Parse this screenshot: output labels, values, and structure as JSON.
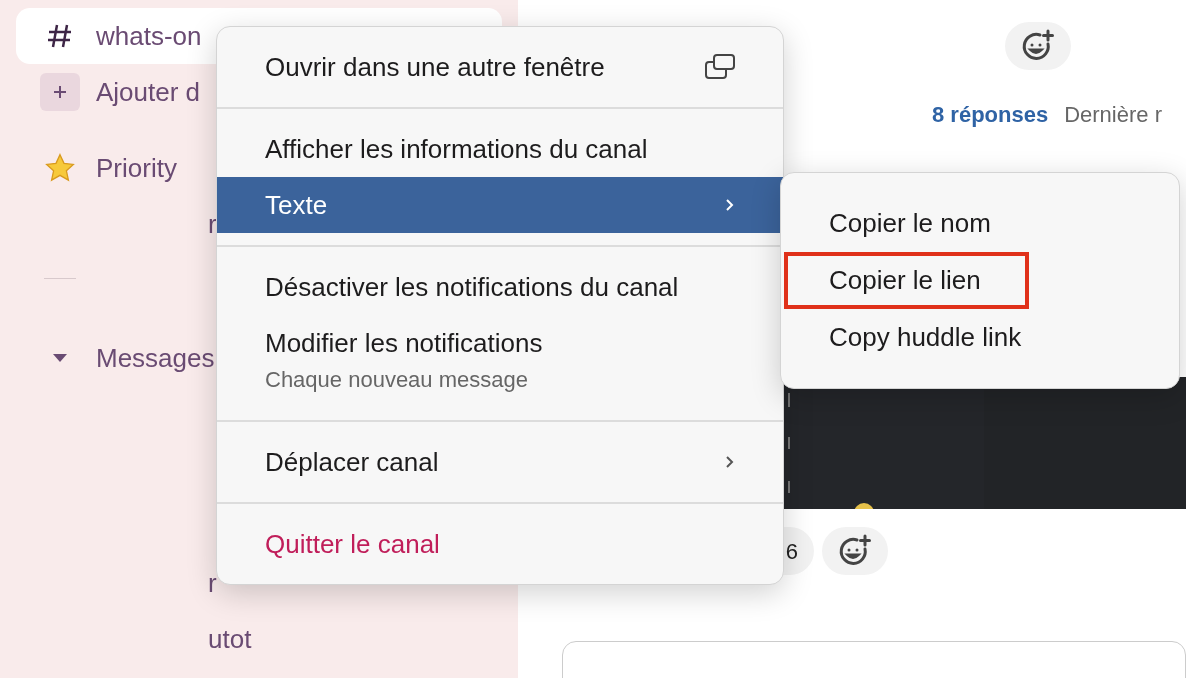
{
  "sidebar": {
    "items": [
      {
        "kind": "channel",
        "label": "whats-on",
        "selected": true
      },
      {
        "kind": "add",
        "label": "Ajouter d",
        "selected": false
      },
      {
        "kind": "star",
        "label": "Priority",
        "selected": false
      },
      {
        "kind": "fragment",
        "label": "r"
      },
      {
        "kind": "rule"
      },
      {
        "kind": "section",
        "label": "Messages",
        "selected": false
      },
      {
        "kind": "fragment",
        "label": "r"
      },
      {
        "kind": "fragment",
        "label": "utot"
      }
    ]
  },
  "thread": {
    "replies": "8 réponses",
    "last_reply": "Dernière r",
    "reaction_count": "6"
  },
  "context_menu": {
    "sections": [
      [
        {
          "label": "Ouvrir dans une autre fenêtre",
          "kind": "window",
          "selected": false
        }
      ],
      [
        {
          "label": "Afficher les informations du canal",
          "kind": "plain",
          "selected": false
        },
        {
          "label": "Texte",
          "kind": "submenu",
          "selected": true
        }
      ],
      [
        {
          "label": "Désactiver les notifications du canal",
          "kind": "plain",
          "selected": false
        },
        {
          "label": "Modifier les notifications",
          "kind": "plain",
          "selected": false,
          "subtitle": "Chaque nouveau message"
        }
      ],
      [
        {
          "label": "Déplacer canal",
          "kind": "submenu",
          "selected": false
        }
      ],
      [
        {
          "label": "Quitter le canal",
          "kind": "danger",
          "selected": false
        }
      ]
    ]
  },
  "submenu": {
    "items": [
      {
        "label": "Copier le nom",
        "highlighted": false
      },
      {
        "label": "Copier le lien",
        "highlighted": true
      },
      {
        "label": "Copy huddle link",
        "highlighted": false
      }
    ]
  }
}
